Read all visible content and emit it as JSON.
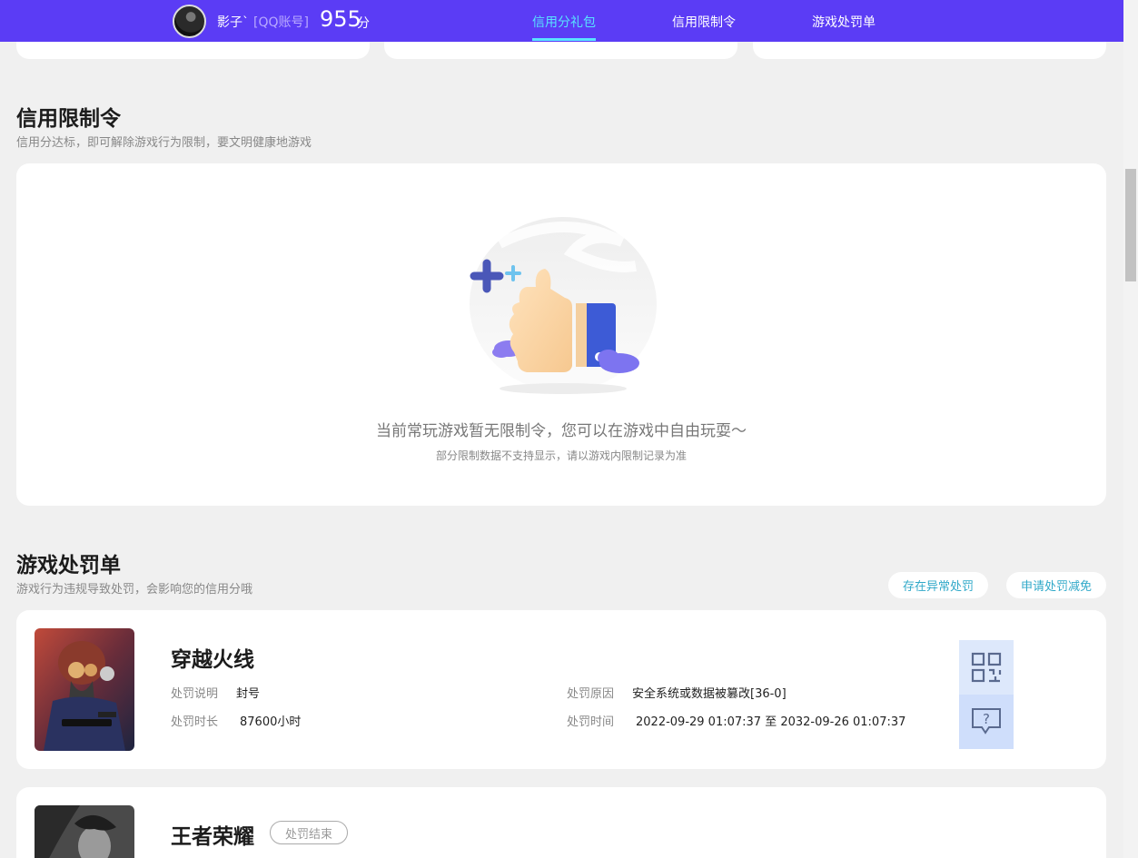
{
  "header": {
    "username": "影子`",
    "account_type": "[QQ账号]",
    "score": "955",
    "score_unit": "分",
    "tabs": [
      {
        "label": "信用分礼包",
        "active": true
      },
      {
        "label": "信用限制令",
        "active": false
      },
      {
        "label": "游戏处罚单",
        "active": false
      }
    ]
  },
  "restriction": {
    "title": "信用限制令",
    "subtitle": "信用分达标，即可解除游戏行为限制，要文明健康地游戏",
    "empty_message": "当前常玩游戏暂无限制令，您可以在游戏中自由玩耍～",
    "empty_note": "部分限制数据不支持显示，请以游戏内限制记录为准"
  },
  "penalty": {
    "title": "游戏处罚单",
    "subtitle": "游戏行为违规导致处罚，会影响您的信用分哦",
    "abnormal_button": "存在异常处罚",
    "reduce_button": "申请处罚减免",
    "records": [
      {
        "game": "穿越火线",
        "desc_label": "处罚说明",
        "desc": "封号",
        "reason_label": "处罚原因",
        "reason": "安全系统或数据被篡改[36-0]",
        "duration_label": "处罚时长",
        "duration": "87600小时",
        "time_label": "处罚时间",
        "time": "2022-09-29 01:07:37 至 2032-09-26 01:07:37"
      },
      {
        "game": "王者荣耀",
        "status": "处罚结束"
      }
    ]
  },
  "icons": {
    "qr": "qrcode-icon",
    "feedback": "question-chat-icon",
    "illustration": "thumbs-up-illustration"
  },
  "colors": {
    "nav_bg": "#5b3cf5",
    "nav_active": "#58e3ff",
    "link": "#31a9c9",
    "side_btn": "#cfdefb",
    "icon": "#5a6a8f"
  }
}
